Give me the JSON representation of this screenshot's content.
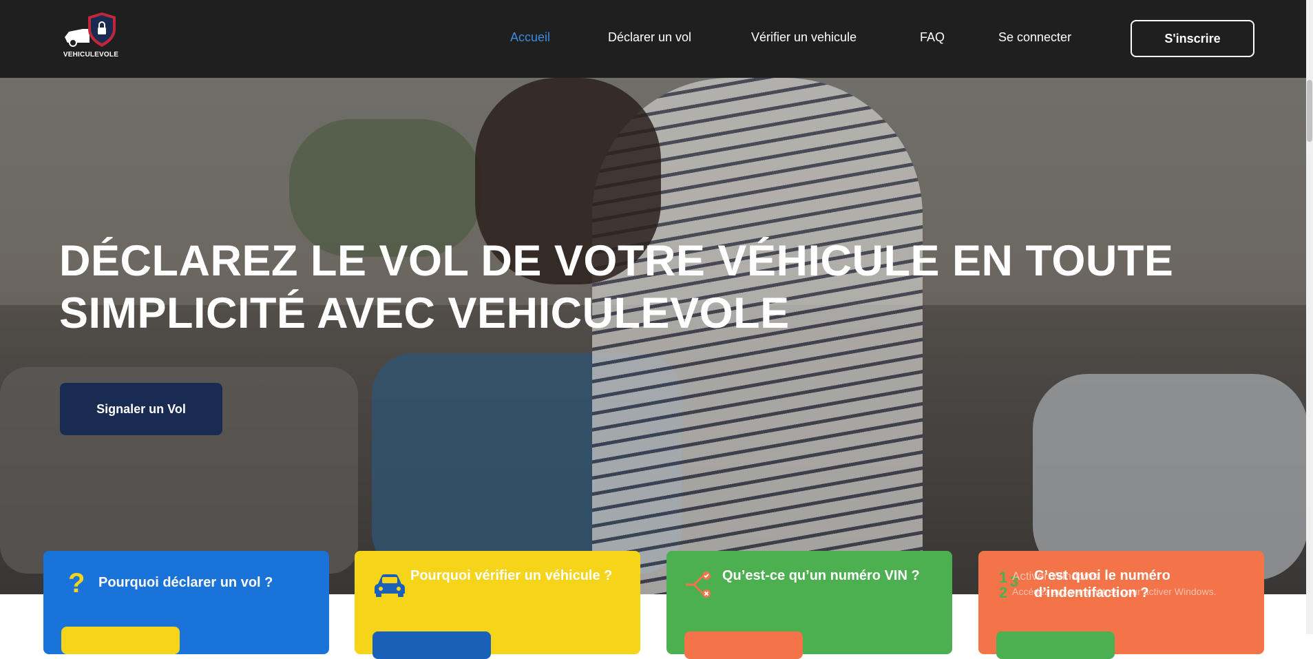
{
  "brand": {
    "name": "VEHICULEVOLE"
  },
  "nav": {
    "items": [
      {
        "label": "Accueil",
        "active": true
      },
      {
        "label": "Déclarer un vol",
        "active": false
      },
      {
        "label": "Vérifier un vehicule",
        "active": false
      },
      {
        "label": "FAQ",
        "active": false
      },
      {
        "label": "Se connecter",
        "active": false
      }
    ],
    "signup_label": "S'inscrire"
  },
  "hero": {
    "title": "DÉCLAREZ LE VOL DE VOTRE VÉHICULE EN TOUTE SIMPLICITÉ AVEC VEHICULEVOLE",
    "cta_label": "Signaler un Vol"
  },
  "cards": [
    {
      "title": "Pourquoi déclarer un vol ?",
      "color": "#1a73d9",
      "icon": "question-icon",
      "button_color": "#f5d41a"
    },
    {
      "title": "Pourquoi vérifier un véhicule ?",
      "color": "#f5d41a",
      "icon": "car-icon",
      "button_color": "#1a5fb8"
    },
    {
      "title": "Qu’est-ce qu’un numéro VIN ?",
      "color": "#4caf50",
      "icon": "branch-icon",
      "button_color": "#f37448"
    },
    {
      "title": "C’est quoi le numéro d’indentifaction ?",
      "color": "#f37448",
      "icon": "numbers-icon",
      "button_color": "#4caf50"
    }
  ],
  "watermark": {
    "line1": "Activer Windows",
    "line2": "Accédez aux paramètres pour activer Windows."
  },
  "colors": {
    "navbar": "#1f1f1f",
    "active_link": "#3b8be0",
    "hero_button": "#1a2b52"
  }
}
